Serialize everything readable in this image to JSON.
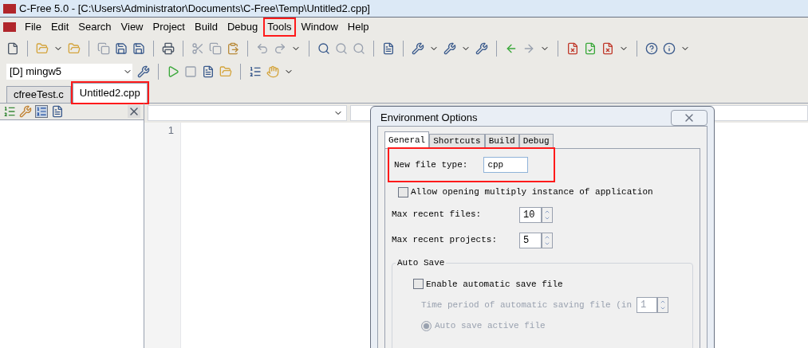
{
  "window": {
    "title": "C-Free 5.0 - [C:\\Users\\Administrator\\Documents\\C-Free\\Temp\\Untitled2.cpp]"
  },
  "menu": [
    {
      "label": "File",
      "highlighted": false
    },
    {
      "label": "Edit",
      "highlighted": false
    },
    {
      "label": "Search",
      "highlighted": false
    },
    {
      "label": "View",
      "highlighted": false
    },
    {
      "label": "Project",
      "highlighted": false
    },
    {
      "label": "Build",
      "highlighted": false
    },
    {
      "label": "Debug",
      "highlighted": false
    },
    {
      "label": "Tools",
      "highlighted": true
    },
    {
      "label": "Window",
      "highlighted": false
    },
    {
      "label": "Help",
      "highlighted": false
    }
  ],
  "compiler_select": {
    "value": "[D] mingw5"
  },
  "file_tabs": [
    {
      "label": "cfreeTest.c",
      "selected": false,
      "highlighted": false
    },
    {
      "label": "Untitled2.cpp",
      "selected": true,
      "highlighted": true
    }
  ],
  "editor": {
    "line_numbers": [
      "1"
    ]
  },
  "dialog": {
    "title": "Environment Options",
    "tabs": [
      {
        "label": "General",
        "selected": true
      },
      {
        "label": "Shortcuts",
        "selected": false
      },
      {
        "label": "Build",
        "selected": false
      },
      {
        "label": "Debug",
        "selected": false
      }
    ],
    "new_file_type": {
      "label": "New file type:",
      "value": "cpp",
      "highlighted": true
    },
    "allow_multiple": {
      "label": "Allow opening multiply instance of application",
      "checked": false
    },
    "max_recent_files": {
      "label": "Max recent files:",
      "value": "10"
    },
    "max_recent_projects": {
      "label": "Max recent projects:",
      "value": "5"
    },
    "auto_save": {
      "title": "Auto Save",
      "enable": {
        "label": "Enable automatic save file",
        "checked": false
      },
      "period": {
        "label": "Time period of automatic saving file (in",
        "value": "1",
        "disabled": true
      },
      "modes": [
        {
          "label": "Auto save active file",
          "selected": true,
          "disabled": true
        }
      ]
    }
  }
}
